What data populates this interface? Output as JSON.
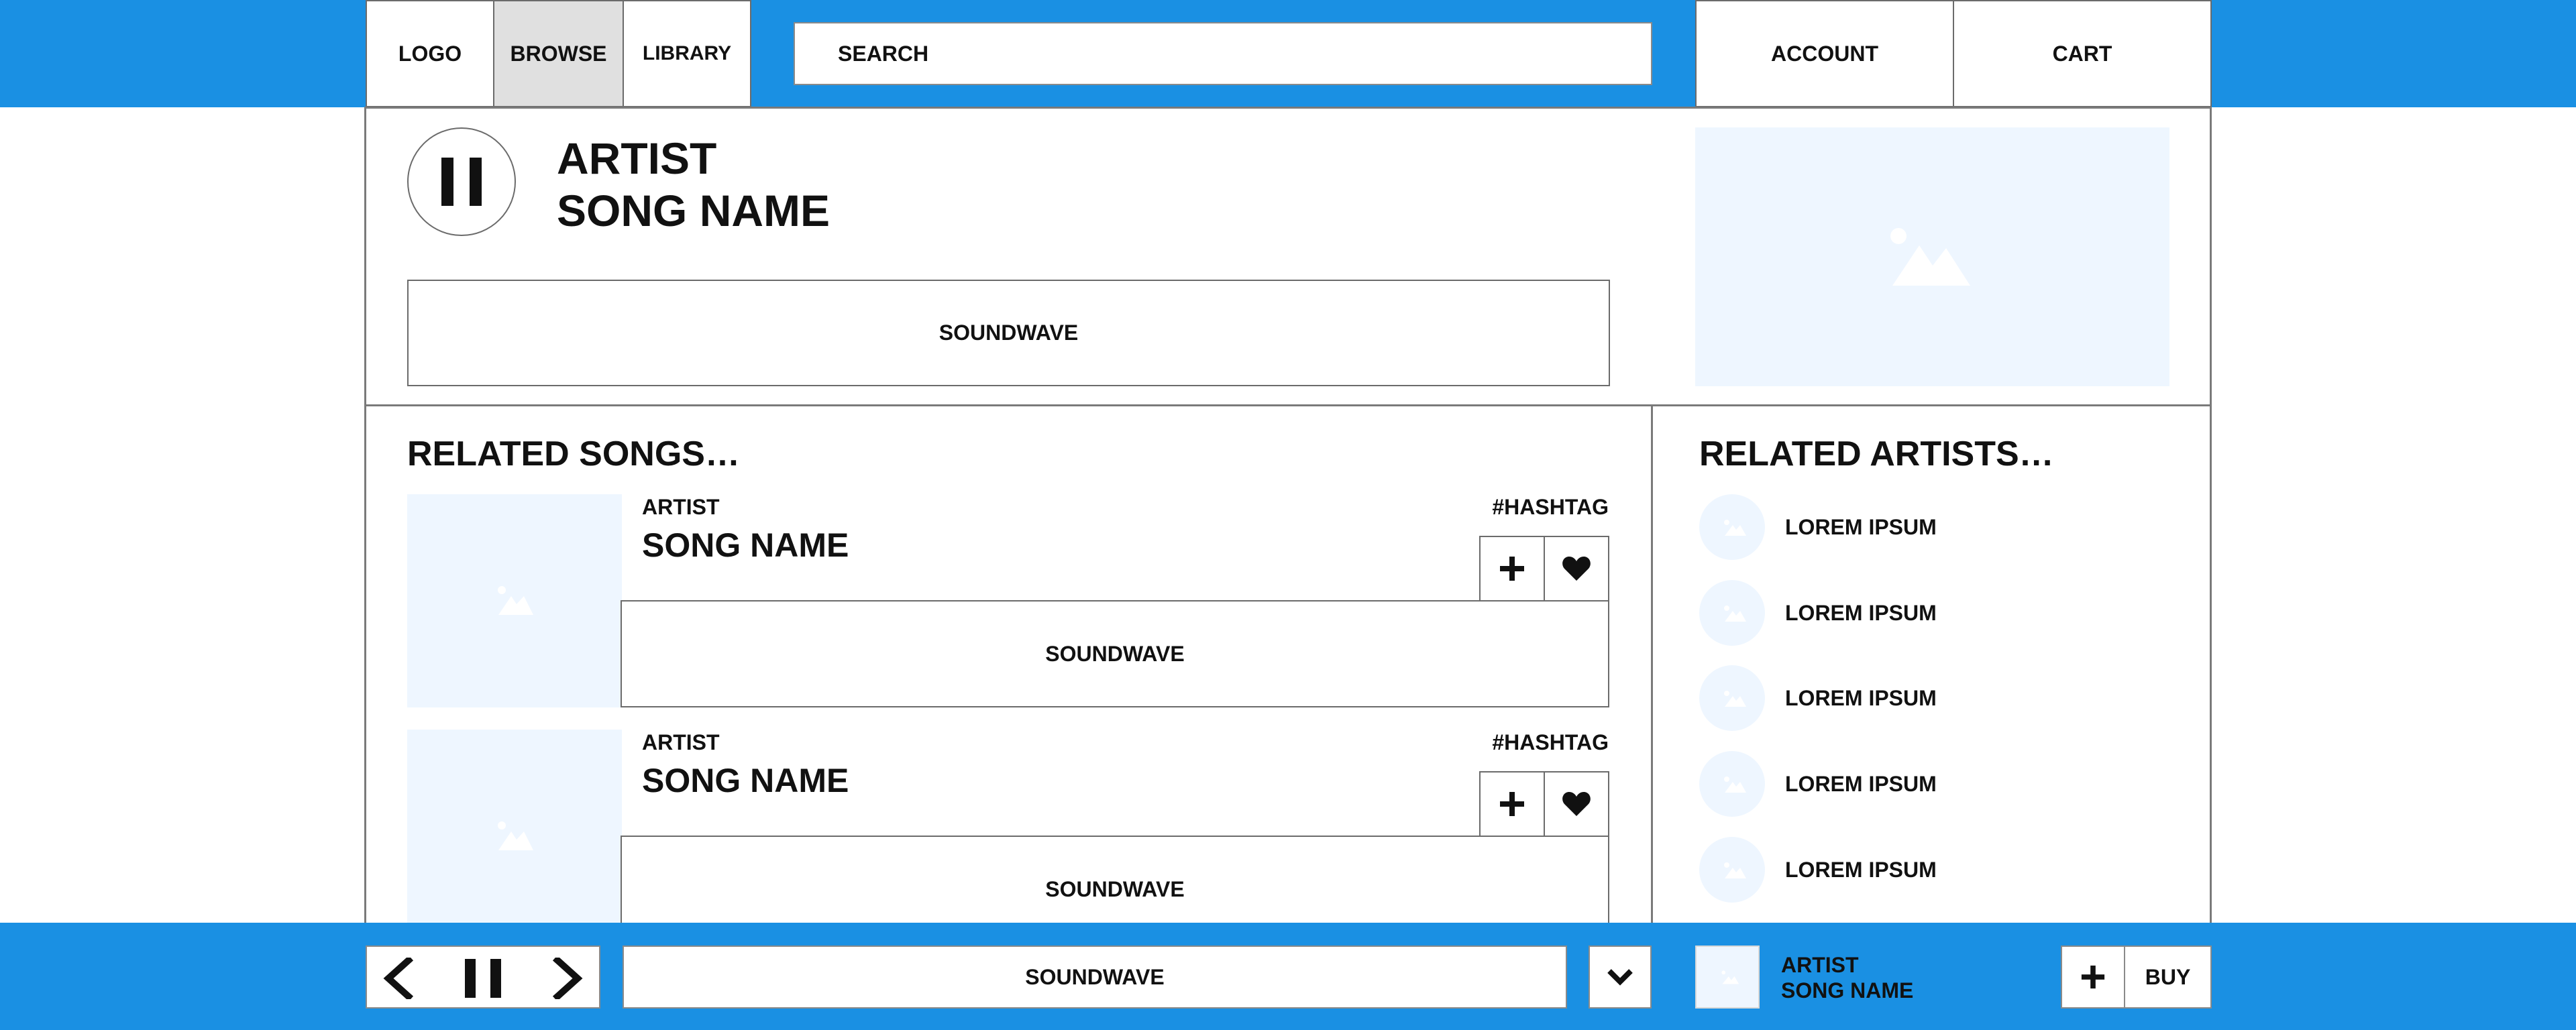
{
  "header": {
    "logo": "LOGO",
    "browse": "BROWSE",
    "library": "LIBRARY",
    "search_placeholder": "SEARCH",
    "account": "ACCOUNT",
    "cart": "CART"
  },
  "now_playing": {
    "artist": "ARTIST",
    "song": "SONG NAME",
    "soundwave": "SOUNDWAVE",
    "pause_icon": "pause-icon",
    "artwork_icon": "image-placeholder-icon"
  },
  "related_songs": {
    "title": "RELATED SONGS…",
    "items": [
      {
        "artist": "ARTIST",
        "song": "SONG NAME",
        "hashtag": "#HASHTAG",
        "soundwave": "SOUNDWAVE"
      },
      {
        "artist": "ARTIST",
        "song": "SONG NAME",
        "hashtag": "#HASHTAG",
        "soundwave": "SOUNDWAVE"
      }
    ]
  },
  "related_artists": {
    "title": "RELATED ARTISTS…",
    "items": [
      "LOREM IPSUM",
      "LOREM IPSUM",
      "LOREM IPSUM",
      "LOREM IPSUM",
      "LOREM IPSUM"
    ]
  },
  "player": {
    "soundwave": "SOUNDWAVE",
    "artist": "ARTIST",
    "song": "SONG NAME",
    "buy": "BUY"
  },
  "colors": {
    "accent_blue": "#1a90e3",
    "placeholder_fill": "#eef6ff",
    "browse_active_bg": "#e0e0e0",
    "border": "#6b6b6b"
  }
}
